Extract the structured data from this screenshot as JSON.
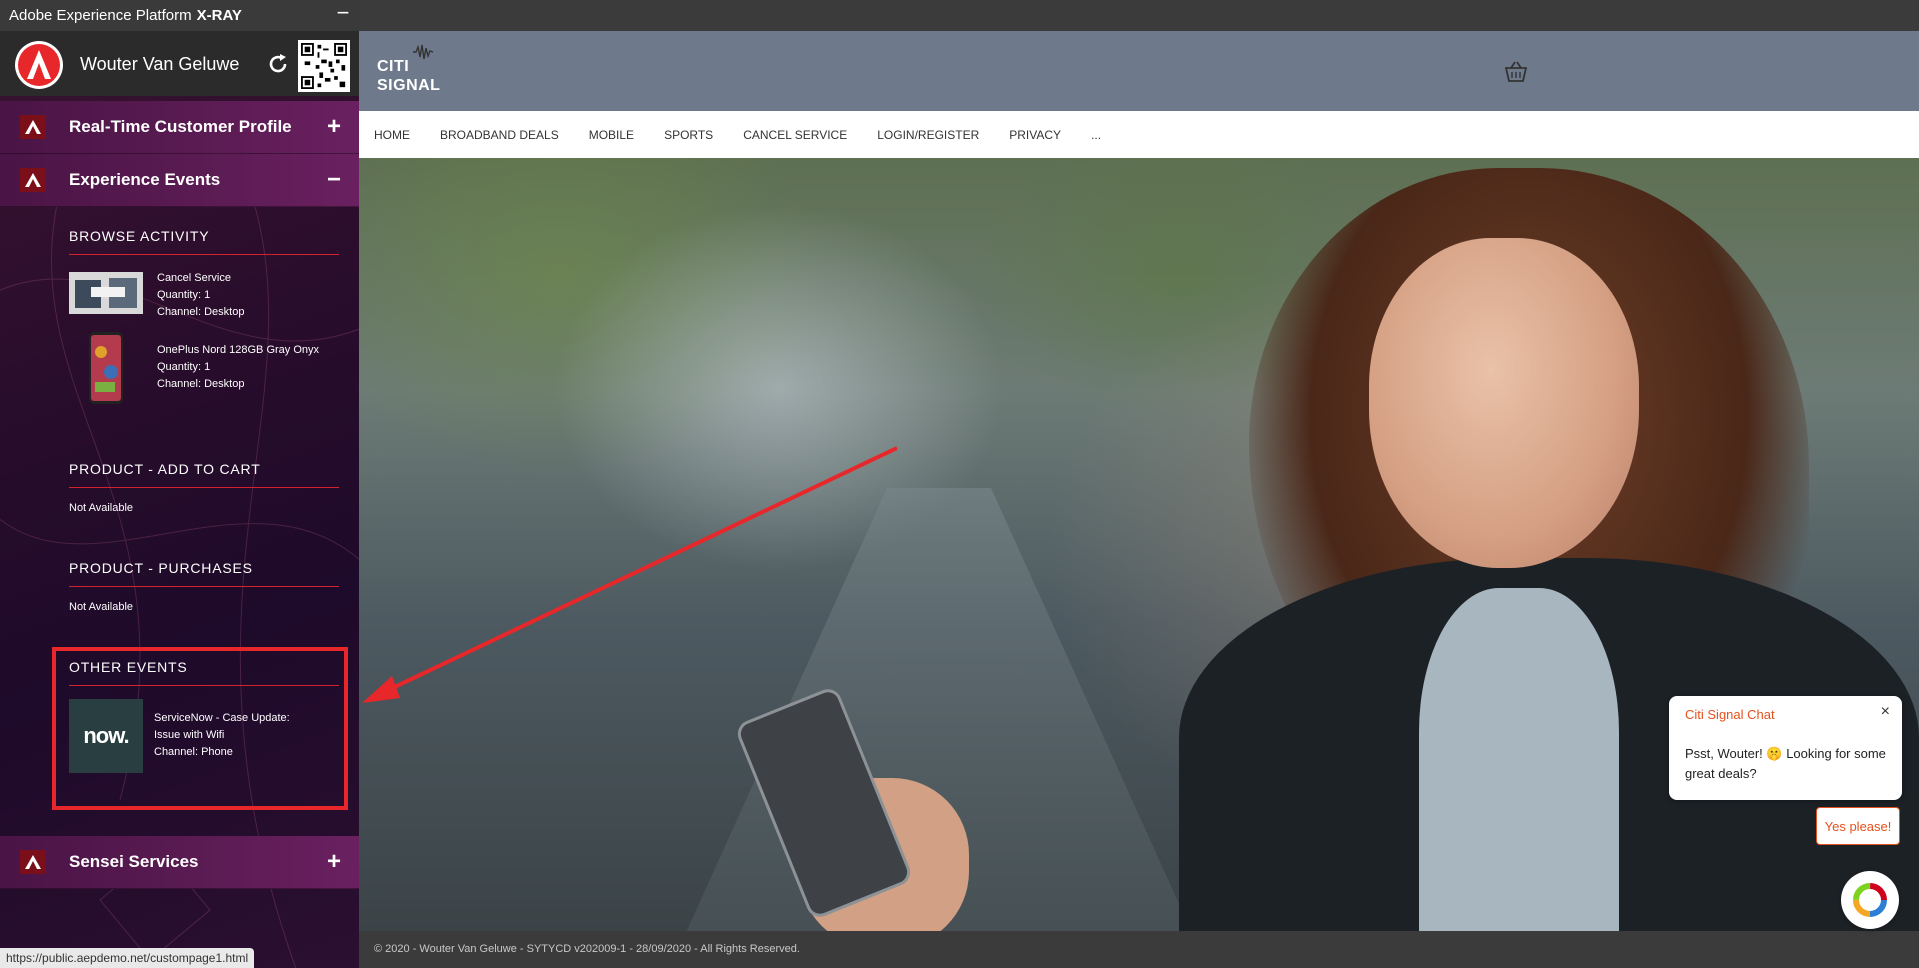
{
  "xray": {
    "title_prefix": "Adobe Experience Platform",
    "title_bold": "X-RAY",
    "minimize_label": "−",
    "user_name": "Wouter Van Geluwe",
    "sections": {
      "profile": {
        "label": "Real-Time Customer Profile",
        "toggle": "+"
      },
      "events": {
        "label": "Experience Events",
        "toggle": "−"
      },
      "sensei": {
        "label": "Sensei Services",
        "toggle": "+"
      }
    },
    "browse_activity": {
      "heading": "BROWSE ACTIVITY",
      "items": [
        {
          "name": "Cancel Service",
          "quantity": "Quantity: 1",
          "channel": "Channel: Desktop"
        },
        {
          "name": "OnePlus Nord 128GB Gray Onyx",
          "quantity": "Quantity: 1",
          "channel": "Channel: Desktop"
        }
      ]
    },
    "add_to_cart": {
      "heading": "PRODUCT - ADD TO CART",
      "value": "Not Available"
    },
    "purchases": {
      "heading": "PRODUCT - PURCHASES",
      "value": "Not Available"
    },
    "other_events": {
      "heading": "OTHER EVENTS",
      "items": [
        {
          "thumb_text": "now.",
          "name": "ServiceNow - Case Update: Issue with Wifi",
          "channel": "Channel: Phone"
        }
      ]
    },
    "status_url": "https://public.aepdemo.net/custompage1.html"
  },
  "site": {
    "brand_line1": "CITI",
    "brand_line2": "SIGNAL",
    "nav": [
      "HOME",
      "BROADBAND DEALS",
      "MOBILE",
      "SPORTS",
      "CANCEL SERVICE",
      "LOGIN/REGISTER",
      "PRIVACY",
      "..."
    ],
    "footer": "© 2020 - Wouter Van Geluwe - SYTYCD v202009-1 - 28/09/2020 - All Rights Reserved.",
    "chat": {
      "title": "Citi Signal Chat",
      "close": "×",
      "message": "Psst, Wouter! 🤫 Looking for some great deals?",
      "cta": "Yes please!"
    }
  },
  "colors": {
    "adobe_red": "#e8272a",
    "header_slate": "#6e7a8c",
    "chat_accent": "#e3521e",
    "panel_purple": "#2a0d2c"
  },
  "icons": [
    "adobe-logo-icon",
    "refresh-icon",
    "qr-code-icon",
    "cart-icon",
    "close-icon",
    "chat-bubble-icon",
    "red-arrow-annotation"
  ]
}
